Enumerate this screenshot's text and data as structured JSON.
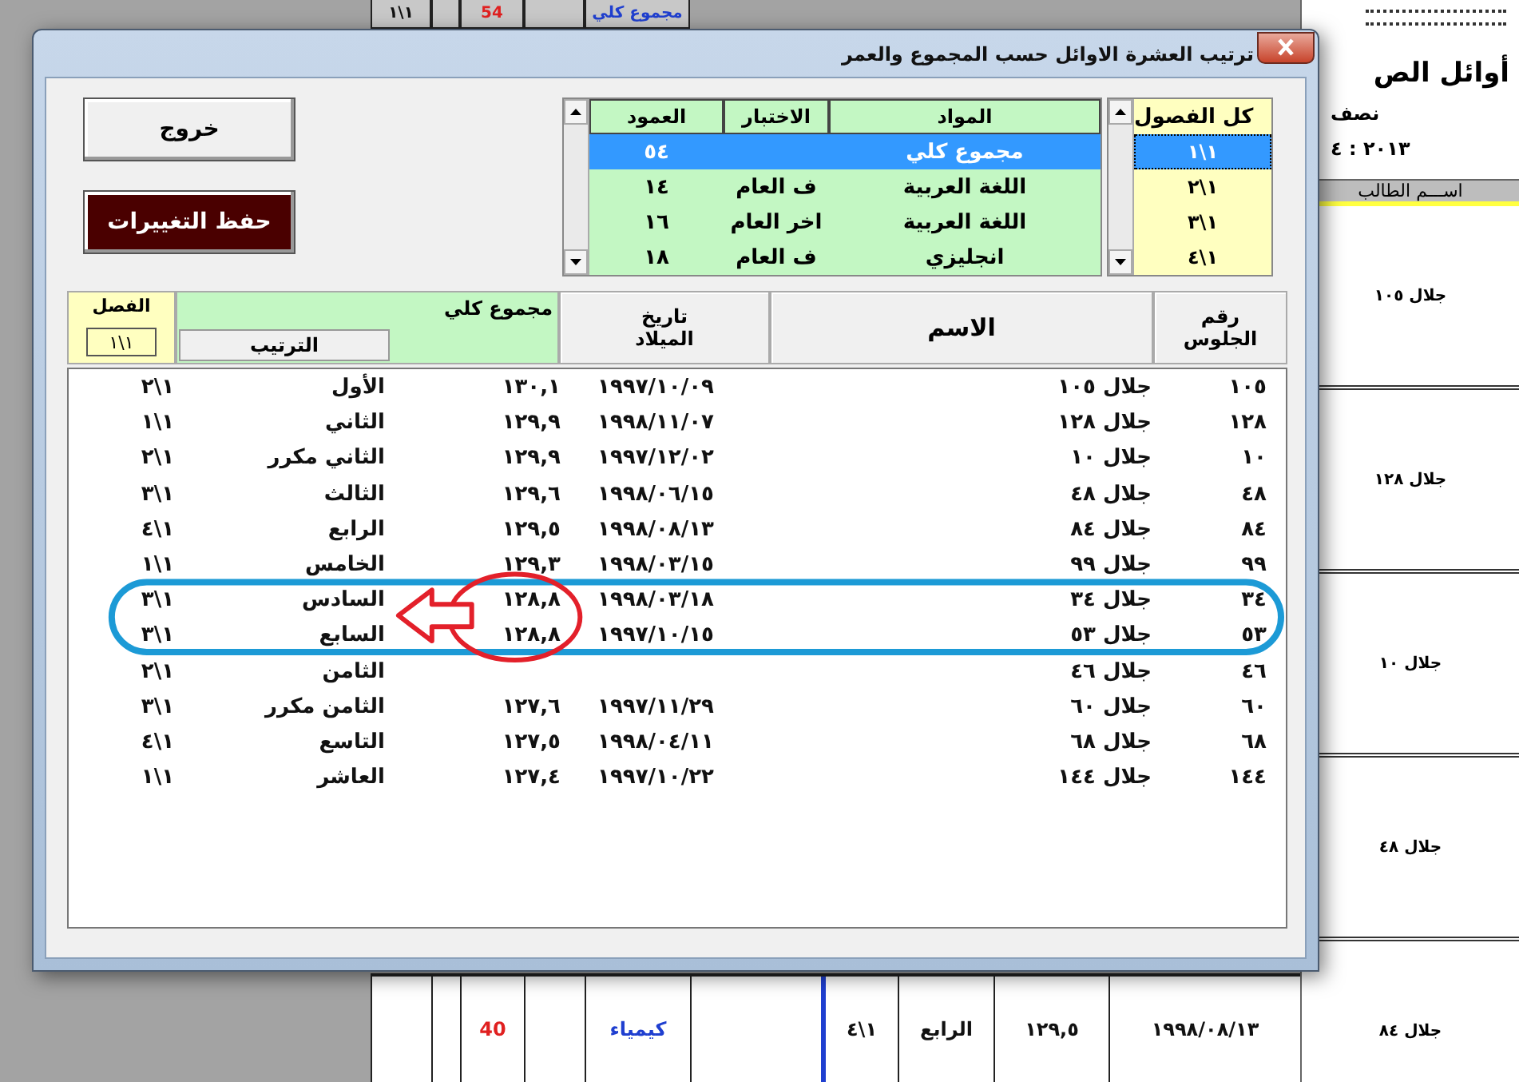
{
  "background_sheet": {
    "top_row": {
      "class": "١\\١",
      "score": "54",
      "subject": "مجموع كلي"
    },
    "title": "أوائل الص",
    "subtitle": "نصف",
    "year": "٢٠١٣ : ٤",
    "name_header": "اســـم الطالب",
    "names": [
      "جلال ١٠٥",
      "جلال ١٢٨",
      "جلال ١٠",
      "جلال ٤٨",
      "جلال ٨٤"
    ],
    "bottom_row": {
      "score": "40",
      "subject": "كيمياء",
      "class": "١\\٤",
      "rank": "الرابع",
      "total": "١٢٩,٥",
      "birth_date": "١٩٩٨/٠٨/١٣"
    }
  },
  "dialog": {
    "title": "ترتيب العشرة الاوائل حسب المجموع والعمر",
    "buttons": [
      {
        "label": "خروج",
        "kind": "plain"
      },
      {
        "label": "حفظ التغييرات",
        "kind": "dark"
      }
    ],
    "subjects": {
      "columns": [
        "المواد",
        "الاختبار",
        "العمود"
      ],
      "rows": [
        {
          "column": "٥٤",
          "subject": "مجموع كلي",
          "selected": true
        },
        {
          "column": "١٤",
          "test": "ف العام",
          "subject": "اللغة العربية",
          "selected": false
        },
        {
          "column": "١٦",
          "test": "اخر العام",
          "subject": "اللغة العربية",
          "selected": false
        },
        {
          "column": "١٨",
          "test": "ف العام",
          "subject": "انجليزي",
          "selected": false
        }
      ]
    },
    "classes": {
      "header": "كل الفصول",
      "items": [
        {
          "label": "١\\١",
          "selected": true
        },
        {
          "label": "١\\٢",
          "selected": false
        },
        {
          "label": "١\\٣",
          "selected": false
        },
        {
          "label": "١\\٤",
          "selected": false
        }
      ]
    },
    "table": {
      "headers": {
        "seat": "رقم الجلوس",
        "name": "الاسم",
        "birth_date": "تاريخ الميلاد",
        "total": "مجموع كلي",
        "rank": "الترتيب",
        "class": "الفصل"
      },
      "class_filter": "١\\١",
      "rows": [
        {
          "seat": "١٠٥",
          "name": "جلال ١٠٥",
          "birth_date": "١٩٩٧/١٠/٠٩",
          "total": "١٣٠,١",
          "rank": "الأول",
          "class": "١\\٢"
        },
        {
          "seat": "١٢٨",
          "name": "جلال ١٢٨",
          "birth_date": "١٩٩٨/١١/٠٧",
          "total": "١٢٩,٩",
          "rank": "الثاني",
          "class": "١\\١"
        },
        {
          "seat": "١٠",
          "name": "جلال ١٠",
          "birth_date": "١٩٩٧/١٢/٠٢",
          "total": "١٢٩,٩",
          "rank": "الثاني مكرر",
          "class": "١\\٢"
        },
        {
          "seat": "٤٨",
          "name": "جلال ٤٨",
          "birth_date": "١٩٩٨/٠٦/١٥",
          "total": "١٢٩,٦",
          "rank": "الثالث",
          "class": "١\\٣"
        },
        {
          "seat": "٨٤",
          "name": "جلال ٨٤",
          "birth_date": "١٩٩٨/٠٨/١٣",
          "total": "١٢٩,٥",
          "rank": "الرابع",
          "class": "١\\٤"
        },
        {
          "seat": "٩٩",
          "name": "جلال ٩٩",
          "birth_date": "١٩٩٨/٠٣/١٥",
          "total": "١٢٩,٣",
          "rank": "الخامس",
          "class": "١\\١"
        },
        {
          "seat": "٣٤",
          "name": "جلال ٣٤",
          "birth_date": "١٩٩٨/٠٣/١٨",
          "total": "١٢٨,٨",
          "rank": "السادس",
          "class": "١\\٣"
        },
        {
          "seat": "٥٣",
          "name": "جلال ٥٣",
          "birth_date": "١٩٩٧/١٠/١٥",
          "total": "١٢٨,٨",
          "rank": "السابع",
          "class": "١\\٣"
        },
        {
          "seat": "٤٦",
          "name": "جلال ٤٦",
          "rank": "الثامن",
          "class": "١\\٢"
        },
        {
          "seat": "٦٠",
          "name": "جلال ٦٠",
          "birth_date": "١٩٩٧/١١/٢٩",
          "total": "١٢٧,٦",
          "rank": "الثامن مكرر",
          "class": "١\\٣"
        },
        {
          "seat": "٦٨",
          "name": "جلال ٦٨",
          "birth_date": "١٩٩٨/٠٤/١١",
          "total": "١٢٧,٥",
          "rank": "التاسع",
          "class": "١\\٤"
        },
        {
          "seat": "١٤٤",
          "name": "جلال ١٤٤",
          "birth_date": "١٩٩٧/١٠/٢٢",
          "total": "١٢٧,٤",
          "rank": "العاشر",
          "class": "١\\١"
        }
      ]
    }
  }
}
